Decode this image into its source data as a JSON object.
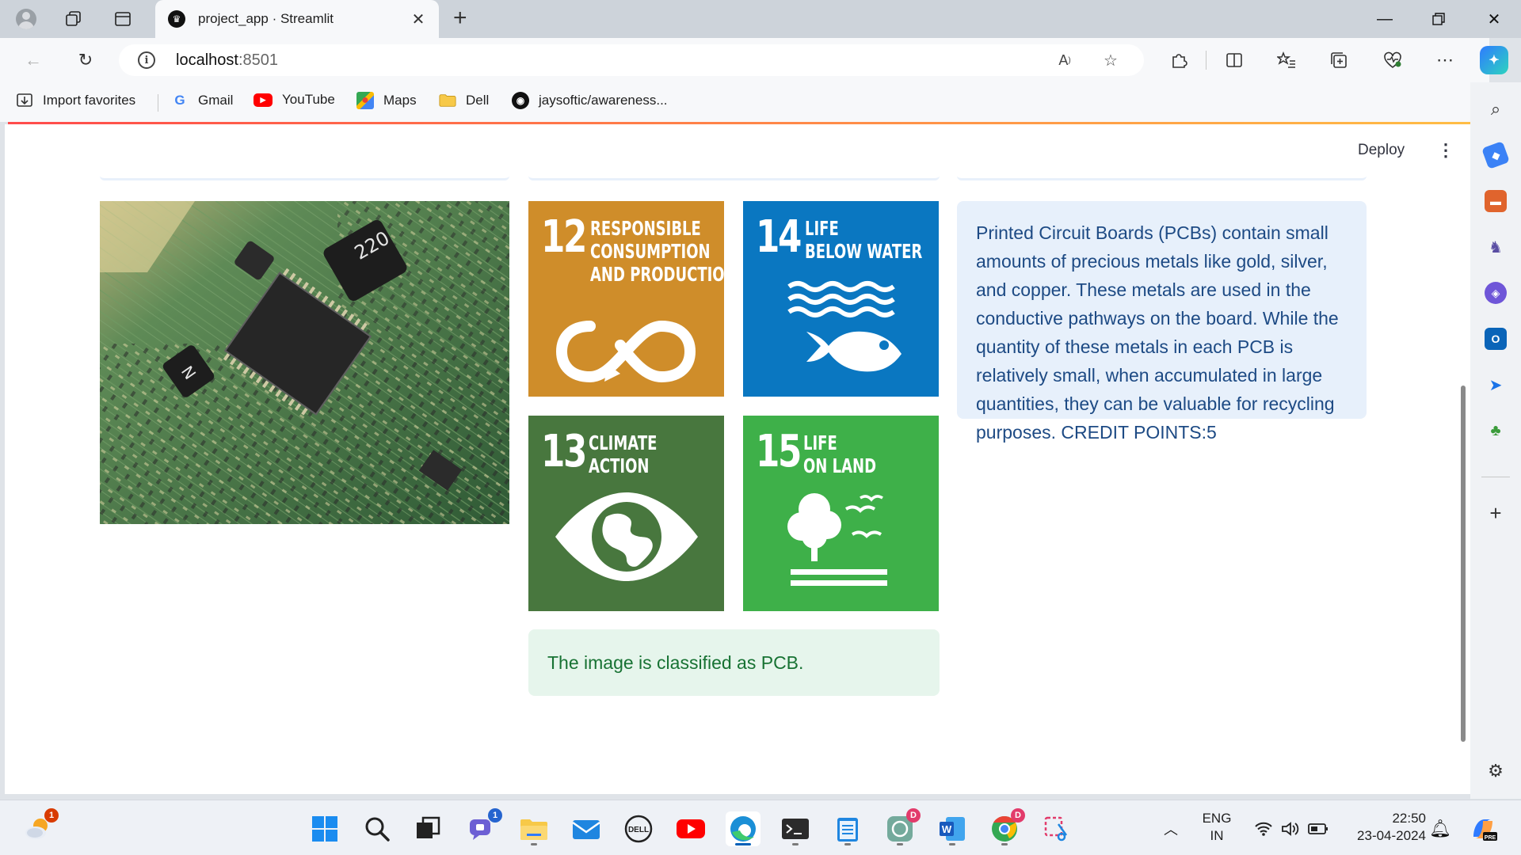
{
  "browser": {
    "tab": {
      "title": "project_app · Streamlit"
    },
    "url": {
      "host": "localhost",
      "port": ":8501"
    },
    "favorites": [
      {
        "label": "Import favorites",
        "icon": "import-favorites-icon"
      },
      {
        "label": "Gmail",
        "icon": "google-icon"
      },
      {
        "label": "YouTube",
        "icon": "youtube-icon"
      },
      {
        "label": "Maps",
        "icon": "maps-icon"
      },
      {
        "label": "Dell",
        "icon": "folder-icon"
      },
      {
        "label": "jaysoftic/awareness...",
        "icon": "github-icon"
      }
    ]
  },
  "app": {
    "deploy_label": "Deploy",
    "sdg_tiles": [
      {
        "number": "12",
        "label_lines": [
          "RESPONSIBLE",
          "CONSUMPTION",
          "AND PRODUCTION"
        ],
        "color": "#cf8d2a",
        "icon": "infinity-loop-icon"
      },
      {
        "number": "14",
        "label_lines": [
          "LIFE",
          "BELOW WATER"
        ],
        "color": "#0a77c1",
        "icon": "fish-waves-icon"
      },
      {
        "number": "13",
        "label_lines": [
          "CLIMATE",
          "ACTION"
        ],
        "color": "#48773e",
        "icon": "eye-globe-icon"
      },
      {
        "number": "15",
        "label_lines": [
          "LIFE",
          "ON LAND"
        ],
        "color": "#3eb049",
        "icon": "tree-birds-icon"
      }
    ],
    "info_text": "Printed Circuit Boards (PCBs) contain small amounts of precious metals like gold, silver, and copper. These metals are used in the conductive pathways on the board. While the quantity of these metals in each PCB is relatively small, when accumulated in large quantities, they can be valuable for recycling purposes. CREDIT POINTS:5",
    "classification_text": "The image is classified as PCB.",
    "pcb_chip_labels": [
      "220",
      "N"
    ]
  },
  "taskbar": {
    "weather_badge": "1",
    "teams_badge": "1",
    "chatgpt_badge": "D",
    "chrome_badge": "D",
    "language": [
      "ENG",
      "IN"
    ],
    "time": "22:50",
    "date": "23-04-2024"
  },
  "colors": {
    "accent": "#ff4b4b",
    "info_bg": "#e7f0fb",
    "info_text": "#1d4a84",
    "success_bg": "#e6f5ec",
    "success_text": "#177233"
  }
}
